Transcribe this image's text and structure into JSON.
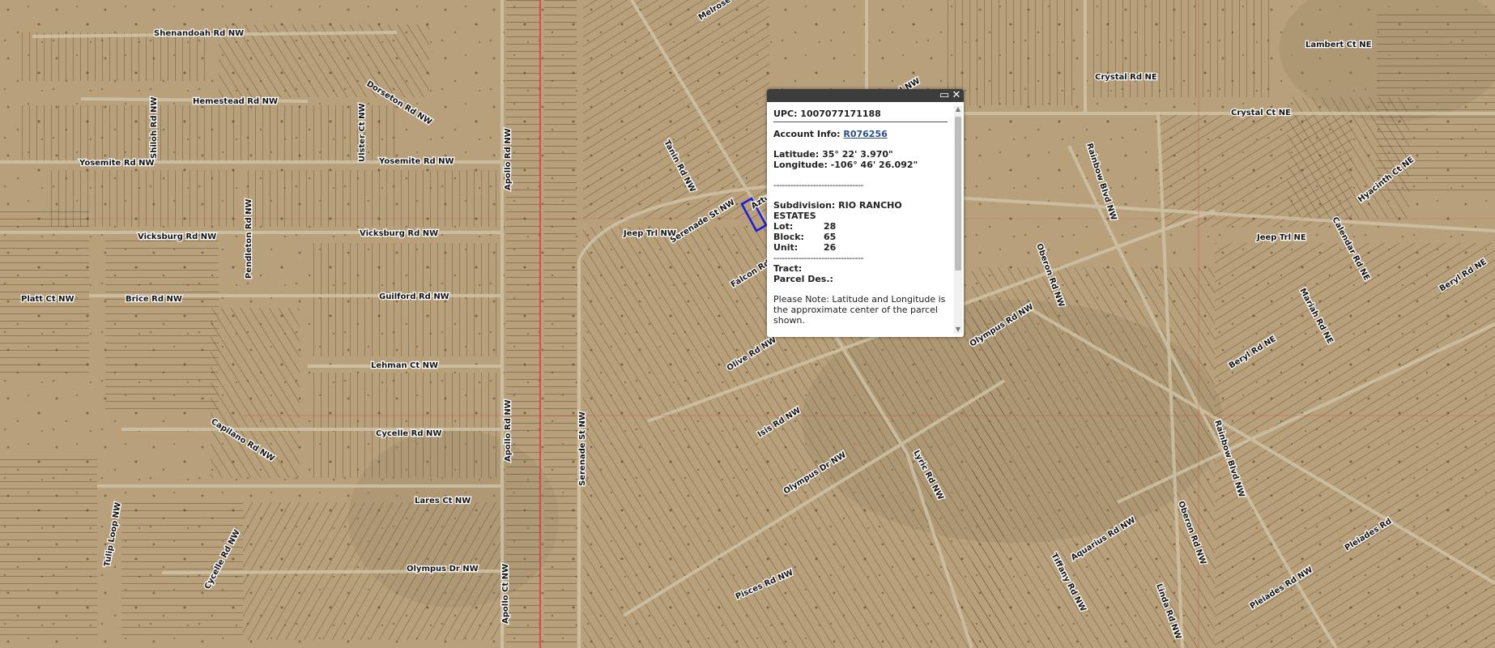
{
  "popup": {
    "upc": "UPC: 1007077171188",
    "account_label": "Account Info:",
    "account_value": "R076256",
    "latitude": "Latitude: 35° 22' 3.970\"",
    "longitude": "Longitude: -106° 46' 26.092\"",
    "separator": "--------------------------------",
    "subdivision_line1": "Subdivision: RIO RANCHO",
    "subdivision_line2": "ESTATES",
    "lot_label": "Lot:",
    "lot_value": "28",
    "block_label": "Block:",
    "block_value": "65",
    "unit_label": "Unit:",
    "unit_value": "26",
    "tract_label": "Tract:",
    "parcel_label": "Parcel Des.:",
    "note": "Please Note: Latitude and Longitude is the approximate center of the parcel shown.",
    "maximize_icon": "maximize-icon",
    "close_icon": "close-icon"
  },
  "road_labels": [
    {
      "text": "Shenandoah Rd NW"
    },
    {
      "text": "Hemestead Rd NW"
    },
    {
      "text": "Yosemite Rd NW"
    },
    {
      "text": "Yosemite Rd NW"
    },
    {
      "text": "Vicksburg Rd NW"
    },
    {
      "text": "Vicksburg Rd NW"
    },
    {
      "text": "Platt Ct NW"
    },
    {
      "text": "Brice Rd NW"
    },
    {
      "text": "Guilford Rd NW"
    },
    {
      "text": "Lehman Ct NW"
    },
    {
      "text": "Cycelle Rd NW"
    },
    {
      "text": "Lares Ct NW"
    },
    {
      "text": "Olympus Dr NW"
    },
    {
      "text": "Apollo Rd NW"
    },
    {
      "text": "Apollo Rd NW"
    },
    {
      "text": "Apollo Ct NW"
    },
    {
      "text": "Serenade St NW"
    },
    {
      "text": "Serenade St NW"
    },
    {
      "text": "Jeep Trl NW"
    },
    {
      "text": "Jeep Trl NE"
    },
    {
      "text": "Crystal Rd NE"
    },
    {
      "text": "Crystal Ct NE"
    },
    {
      "text": "Lambert Ct NE"
    },
    {
      "text": "Hyacinth Ct NE"
    },
    {
      "text": "Rainbow Blvd NW"
    },
    {
      "text": "Rainbow Blvd NW"
    },
    {
      "text": "Oberon Rd NW"
    },
    {
      "text": "Oberon Rd NW"
    },
    {
      "text": "Olympus Rd NW"
    },
    {
      "text": "Olympus Dr NW"
    },
    {
      "text": "Lyric Rd NW"
    },
    {
      "text": "Isis Rd NW"
    },
    {
      "text": "Olive Rd NW"
    },
    {
      "text": "Pisces Rd NW"
    },
    {
      "text": "Tiffany Rd NW"
    },
    {
      "text": "Aquarius Rd NW"
    },
    {
      "text": "Linda Rd NW"
    },
    {
      "text": "Pleiades Rd NW"
    },
    {
      "text": "Pleiades Rd"
    },
    {
      "text": "Beryl Rd NE"
    },
    {
      "text": "Beryl Rd NE"
    },
    {
      "text": "Mariah Rd NE"
    },
    {
      "text": "Calendar Rd NE"
    },
    {
      "text": "Tulip Loop NW"
    },
    {
      "text": "Cycelle Rd NW"
    },
    {
      "text": "Capilano Rd NW"
    },
    {
      "text": "Pendleton Rd NW"
    },
    {
      "text": "Shiloh Rd NW"
    },
    {
      "text": "Ulster Ct NW"
    },
    {
      "text": "Dorseton Rd NW"
    },
    {
      "text": "Falcon Rd NW"
    },
    {
      "text": "Aztec Rd NW"
    },
    {
      "text": "Tanin Rd NW"
    },
    {
      "text": "Melrose Rd NW"
    },
    {
      "text": "Manor Rd NW"
    }
  ],
  "colors": {
    "ground": "#b8a07a",
    "parcel_line": "#3a3126",
    "boundary_red": "#d9363e",
    "selected_parcel": "#1a1ae0"
  }
}
